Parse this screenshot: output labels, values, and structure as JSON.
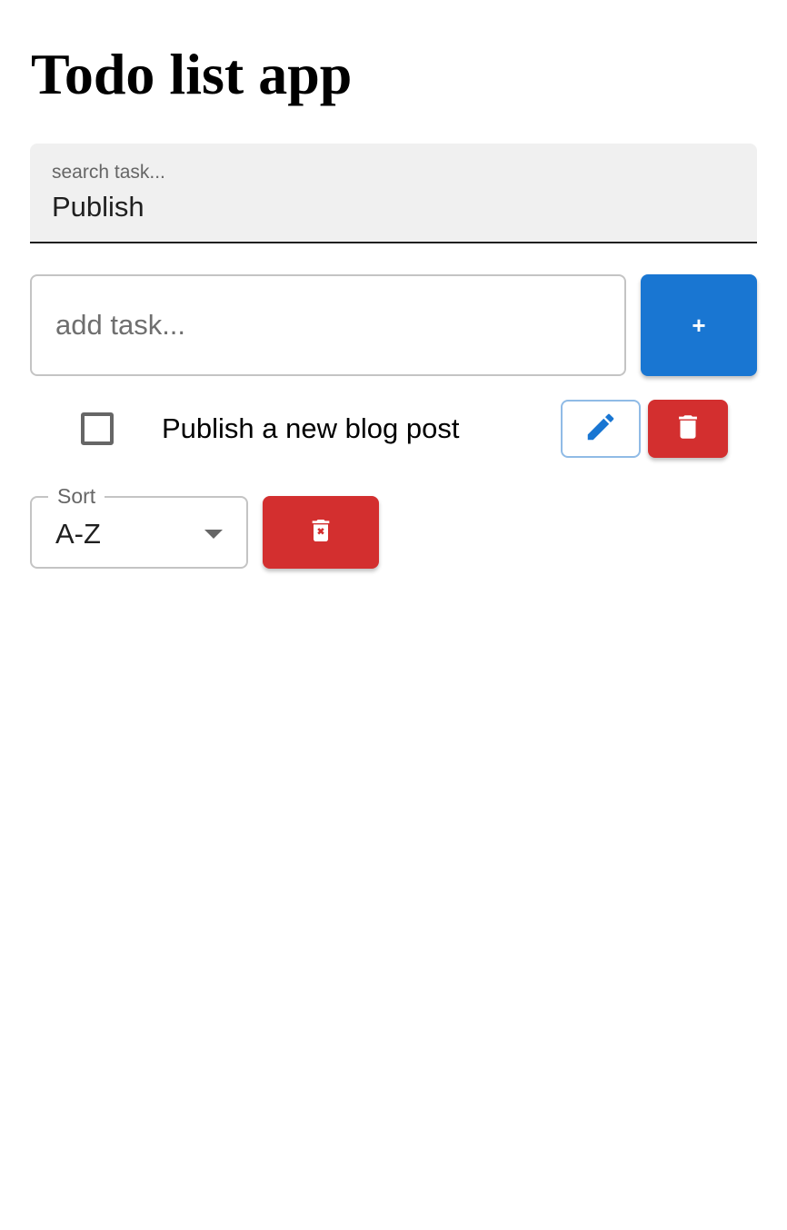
{
  "app": {
    "title": "Todo list app"
  },
  "search": {
    "label": "search task...",
    "value": "Publish"
  },
  "add_task": {
    "placeholder": "add task...",
    "button_label": "+"
  },
  "tasks": [
    {
      "text": "Publish a new blog post",
      "checked": false
    }
  ],
  "sort": {
    "label": "Sort",
    "selected": "A-Z"
  },
  "icons": {
    "edit": "pencil-icon",
    "delete": "trash-icon",
    "clear_all": "trash-x-icon",
    "dropdown": "caret-down-icon"
  },
  "colors": {
    "primary": "#1976d2",
    "danger": "#d32f2f",
    "search_bg": "#f0f0f0"
  }
}
